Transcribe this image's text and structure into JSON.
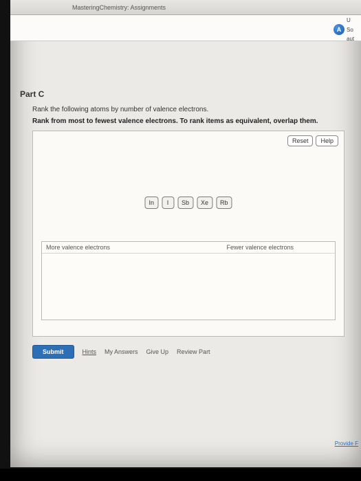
{
  "tab": {
    "title": "MasteringChemistry: Assignments"
  },
  "topRight": {
    "line1": "U",
    "badge": "A",
    "line2": "So",
    "line3": "aut"
  },
  "part": {
    "label": "Part C"
  },
  "question": {
    "prompt": "Rank the following atoms by number of valence electrons.",
    "instruction": "Rank from most to fewest valence electrons. To rank items as equivalent, overlap them."
  },
  "ranking": {
    "reset": "Reset",
    "help": "Help",
    "items": [
      "In",
      "I",
      "Sb",
      "Xe",
      "Rb"
    ],
    "leftLabel": "More valence electrons",
    "rightLabel": "Fewer valence electrons"
  },
  "actions": {
    "submit": "Submit",
    "hints": "Hints",
    "myAnswers": "My Answers",
    "giveUp": "Give Up",
    "reviewPart": "Review Part"
  },
  "footer": {
    "provide": "Provide F"
  }
}
